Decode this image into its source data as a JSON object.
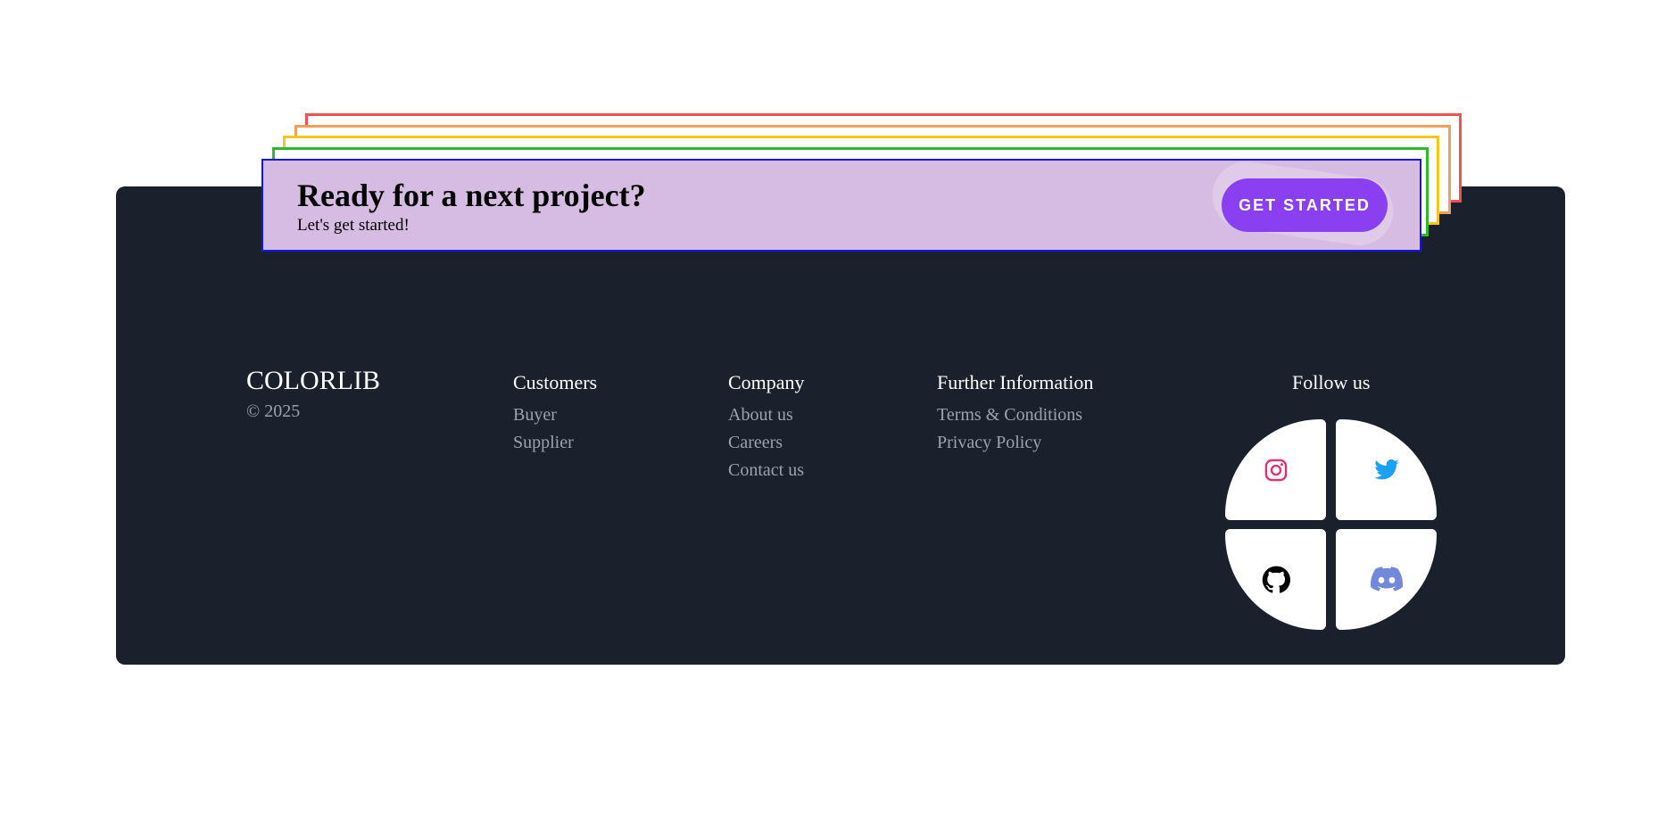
{
  "cta": {
    "title": "Ready for a next project?",
    "subtitle": "Let's get started!",
    "button_label": "GET STARTED"
  },
  "footer": {
    "brand": "COLORLIB",
    "copyright": "© 2025",
    "columns": [
      {
        "heading": "Customers",
        "links": [
          "Buyer",
          "Supplier"
        ]
      },
      {
        "heading": "Company",
        "links": [
          "About us",
          "Careers",
          "Contact us"
        ]
      },
      {
        "heading": "Further Information",
        "links": [
          "Terms & Conditions",
          "Privacy Policy"
        ]
      }
    ],
    "follow_title": "Follow us",
    "social": [
      {
        "icon": "instagram-icon",
        "color": "#e1306c"
      },
      {
        "icon": "twitter-icon",
        "color": "#1da1f2"
      },
      {
        "icon": "github-icon",
        "color": "#000000"
      },
      {
        "icon": "discord-icon",
        "color": "#7289da"
      }
    ]
  },
  "colors": {
    "footer_bg": "#1a202c",
    "cta_bg": "#d6bbe2",
    "button_bg": "#8a3ff0",
    "frames": [
      "#ef5350",
      "#f59e5b",
      "#f5c518",
      "#2eb82e",
      "#1515e6"
    ]
  }
}
